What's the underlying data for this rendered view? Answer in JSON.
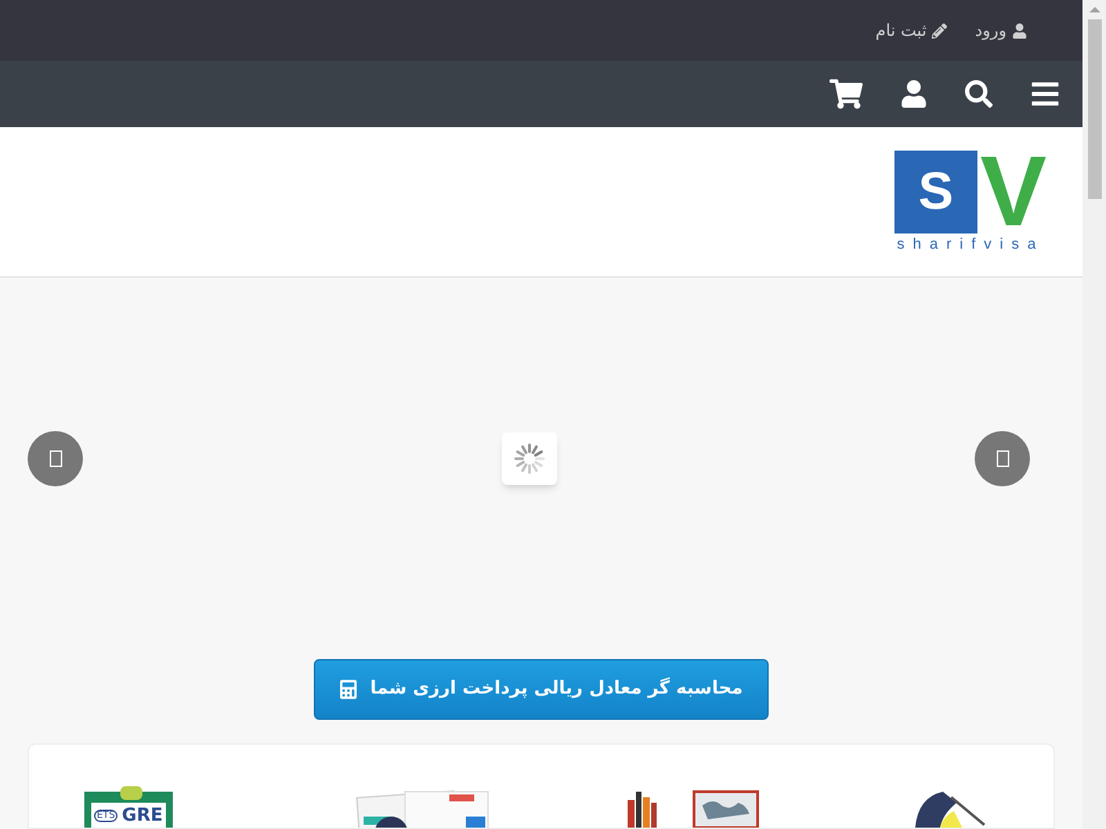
{
  "top_bar": {
    "links": [
      {
        "kind": "login",
        "label": "ورود"
      },
      {
        "kind": "register",
        "label": "ثبت نام"
      }
    ]
  },
  "logo": {
    "letter_1": "S",
    "letter_2": "V",
    "wordmark": "sharifvisa"
  },
  "calculator_button": {
    "label": "محاسبه گر معادل ریالی پرداخت ارزی شما"
  },
  "services": [
    {
      "kind": "lamp"
    },
    {
      "kind": "books-map"
    },
    {
      "kind": "papers"
    },
    {
      "kind": "exam",
      "badge": "ETS",
      "title": "GRE"
    }
  ]
}
